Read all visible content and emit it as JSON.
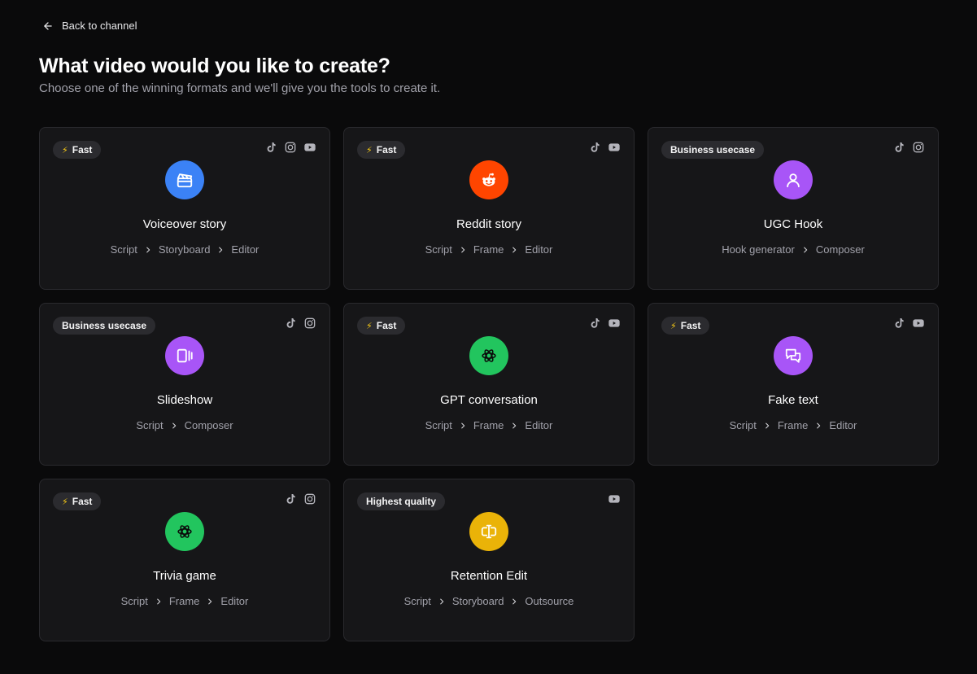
{
  "back_label": "Back to channel",
  "title": "What video would you like to create?",
  "subtitle": "Choose one of the winning formats and we'll give you the tools to create it.",
  "cards": [
    {
      "badge": "Fast",
      "fast": true,
      "title": "Voiceover story",
      "steps": [
        "Script",
        "Storyboard",
        "Editor"
      ],
      "platforms": [
        "tiktok-icon",
        "instagram-icon",
        "youtube-icon"
      ],
      "icon": "clapperboard-icon",
      "color": "#3b82f6"
    },
    {
      "badge": "Fast",
      "fast": true,
      "title": "Reddit story",
      "steps": [
        "Script",
        "Frame",
        "Editor"
      ],
      "platforms": [
        "tiktok-icon",
        "youtube-icon"
      ],
      "icon": "reddit-icon",
      "color": "#ff4500"
    },
    {
      "badge": "Business usecase",
      "fast": false,
      "title": "UGC Hook",
      "steps": [
        "Hook generator",
        "Composer"
      ],
      "platforms": [
        "tiktok-icon",
        "instagram-icon"
      ],
      "icon": "user-icon",
      "color": "#a855f7"
    },
    {
      "badge": "Business usecase",
      "fast": false,
      "title": "Slideshow",
      "steps": [
        "Script",
        "Composer"
      ],
      "platforms": [
        "tiktok-icon",
        "instagram-icon"
      ],
      "icon": "slides-icon",
      "color": "#a855f7"
    },
    {
      "badge": "Fast",
      "fast": true,
      "title": "GPT conversation",
      "steps": [
        "Script",
        "Frame",
        "Editor"
      ],
      "platforms": [
        "tiktok-icon",
        "youtube-icon"
      ],
      "icon": "openai-icon",
      "color": "#22c55e"
    },
    {
      "badge": "Fast",
      "fast": true,
      "title": "Fake text",
      "steps": [
        "Script",
        "Frame",
        "Editor"
      ],
      "platforms": [
        "tiktok-icon",
        "youtube-icon"
      ],
      "icon": "chat-icon",
      "color": "#a855f7"
    },
    {
      "badge": "Fast",
      "fast": true,
      "title": "Trivia game",
      "steps": [
        "Script",
        "Frame",
        "Editor"
      ],
      "platforms": [
        "tiktok-icon",
        "instagram-icon"
      ],
      "icon": "openai-icon",
      "color": "#22c55e"
    },
    {
      "badge": "Highest quality",
      "fast": false,
      "title": "Retention Edit",
      "steps": [
        "Script",
        "Storyboard",
        "Outsource"
      ],
      "platforms": [
        "youtube-icon"
      ],
      "icon": "text-cursor-icon",
      "color": "#eab308"
    }
  ]
}
